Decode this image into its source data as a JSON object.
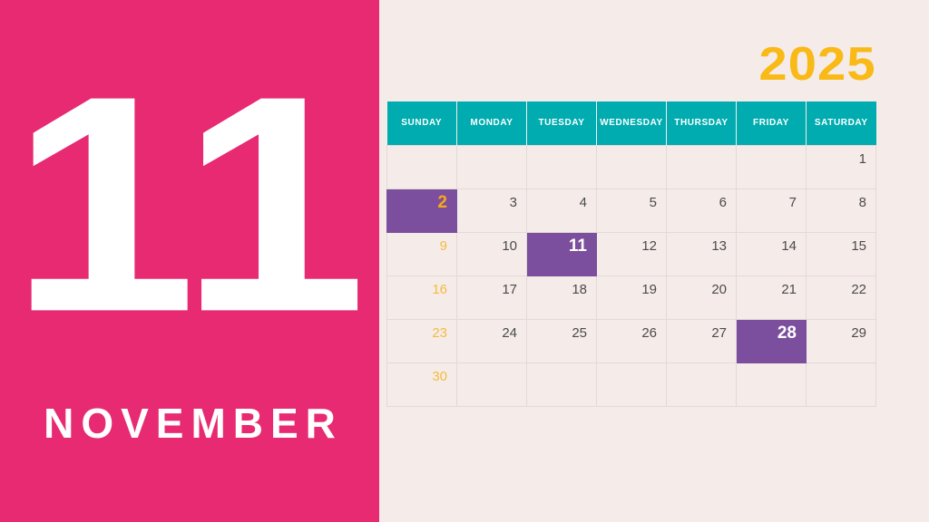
{
  "left_panel": {
    "month_number": "11",
    "month_name": "NOVEMBER",
    "background_color": "#e72a72",
    "text_color": "#ffffff"
  },
  "year": "2025",
  "colors": {
    "pink": "#e72a72",
    "background": "#f5ecea",
    "teal_header": "#00acb0",
    "purple_highlight": "#7b4f9d",
    "gold": "#f9b917",
    "sunday_yellow": "#f5ba3d",
    "weekday_text": "#4a4a4a",
    "grid_line": "#e3d9d7"
  },
  "calendar": {
    "headers": [
      "SUNDAY",
      "MONDAY",
      "TUESDAY",
      "WEDNESDAY",
      "THURSDAY",
      "FRIDAY",
      "SATURDAY"
    ],
    "weeks": [
      [
        {
          "day": "",
          "empty": true
        },
        {
          "day": "",
          "empty": true
        },
        {
          "day": "",
          "empty": true
        },
        {
          "day": "",
          "empty": true
        },
        {
          "day": "",
          "empty": true
        },
        {
          "day": "",
          "empty": true
        },
        {
          "day": "1"
        }
      ],
      [
        {
          "day": "2",
          "highlight": true,
          "sunday": true
        },
        {
          "day": "3"
        },
        {
          "day": "4"
        },
        {
          "day": "5"
        },
        {
          "day": "6"
        },
        {
          "day": "7"
        },
        {
          "day": "8"
        }
      ],
      [
        {
          "day": "9",
          "sunday": true
        },
        {
          "day": "10"
        },
        {
          "day": "11",
          "highlight": true
        },
        {
          "day": "12"
        },
        {
          "day": "13"
        },
        {
          "day": "14"
        },
        {
          "day": "15"
        }
      ],
      [
        {
          "day": "16",
          "sunday": true
        },
        {
          "day": "17"
        },
        {
          "day": "18"
        },
        {
          "day": "19"
        },
        {
          "day": "20"
        },
        {
          "day": "21"
        },
        {
          "day": "22"
        }
      ],
      [
        {
          "day": "23",
          "sunday": true
        },
        {
          "day": "24"
        },
        {
          "day": "25"
        },
        {
          "day": "26"
        },
        {
          "day": "27"
        },
        {
          "day": "28",
          "highlight": true
        },
        {
          "day": "29"
        }
      ],
      [
        {
          "day": "30",
          "sunday": true
        },
        {
          "day": "",
          "empty": true
        },
        {
          "day": "",
          "empty": true
        },
        {
          "day": "",
          "empty": true
        },
        {
          "day": "",
          "empty": true
        },
        {
          "day": "",
          "empty": true
        },
        {
          "day": "",
          "empty": true
        }
      ]
    ]
  }
}
